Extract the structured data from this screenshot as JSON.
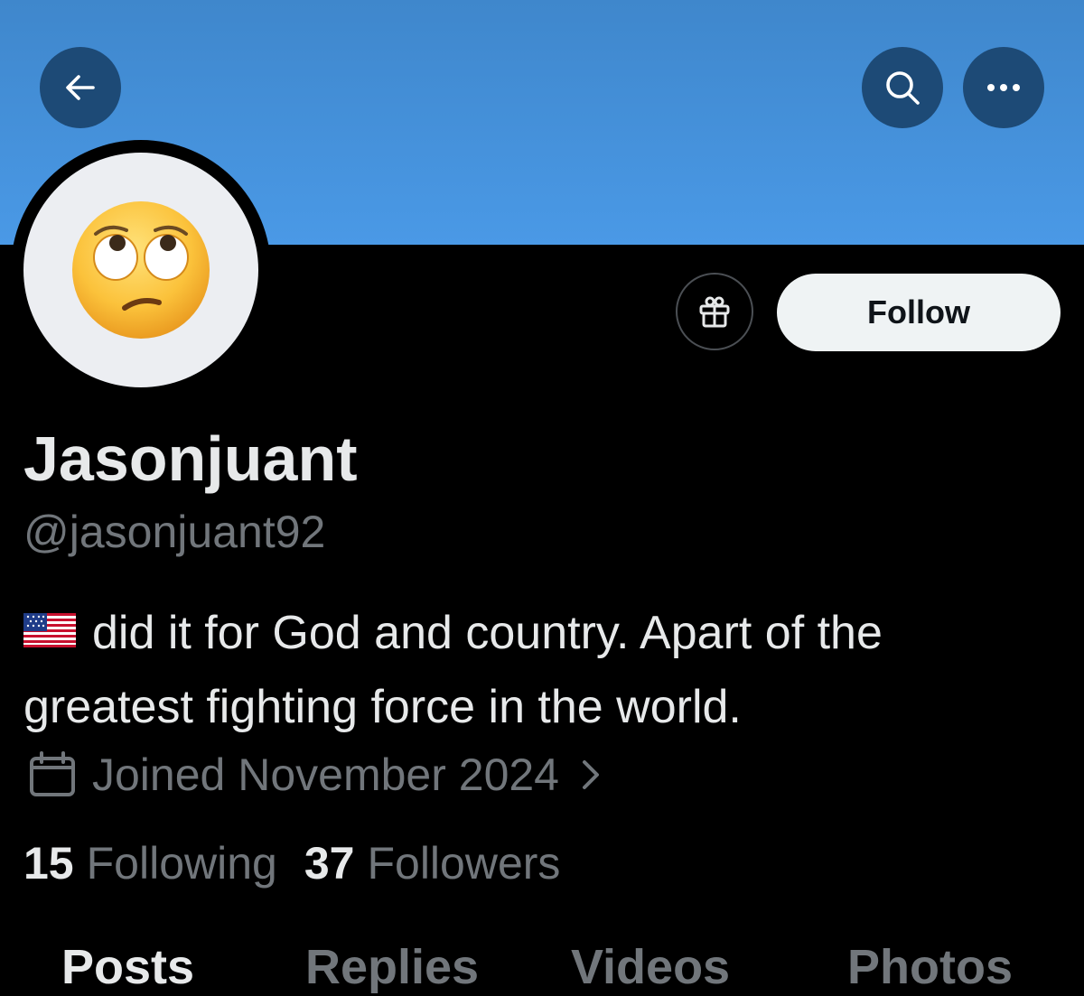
{
  "header": {
    "back_icon": "arrow-left-icon",
    "search_icon": "search-icon",
    "more_icon": "more-horizontal-icon"
  },
  "profile": {
    "avatar_emoji": "🙄",
    "display_name": "Jasonjuant",
    "handle": "@jasonjuant92",
    "bio_flag": "us-flag-icon",
    "bio_text": "did it for God and country. Apart of the greatest fighting force in the world.",
    "joined_text": "Joined November 2024",
    "following_count": "15",
    "following_label": "Following",
    "followers_count": "37",
    "followers_label": "Followers"
  },
  "actions": {
    "gift_icon": "gift-icon",
    "follow_label": "Follow"
  },
  "tabs": [
    {
      "label": "Posts",
      "active": true
    },
    {
      "label": "Replies",
      "active": false
    },
    {
      "label": "Videos",
      "active": false
    },
    {
      "label": "Photos",
      "active": false
    }
  ],
  "colors": {
    "banner": "#4a99e6",
    "background": "#000000",
    "primary_text": "#e7e9ea",
    "secondary_text": "#71767b",
    "follow_button_bg": "#eff3f4"
  }
}
